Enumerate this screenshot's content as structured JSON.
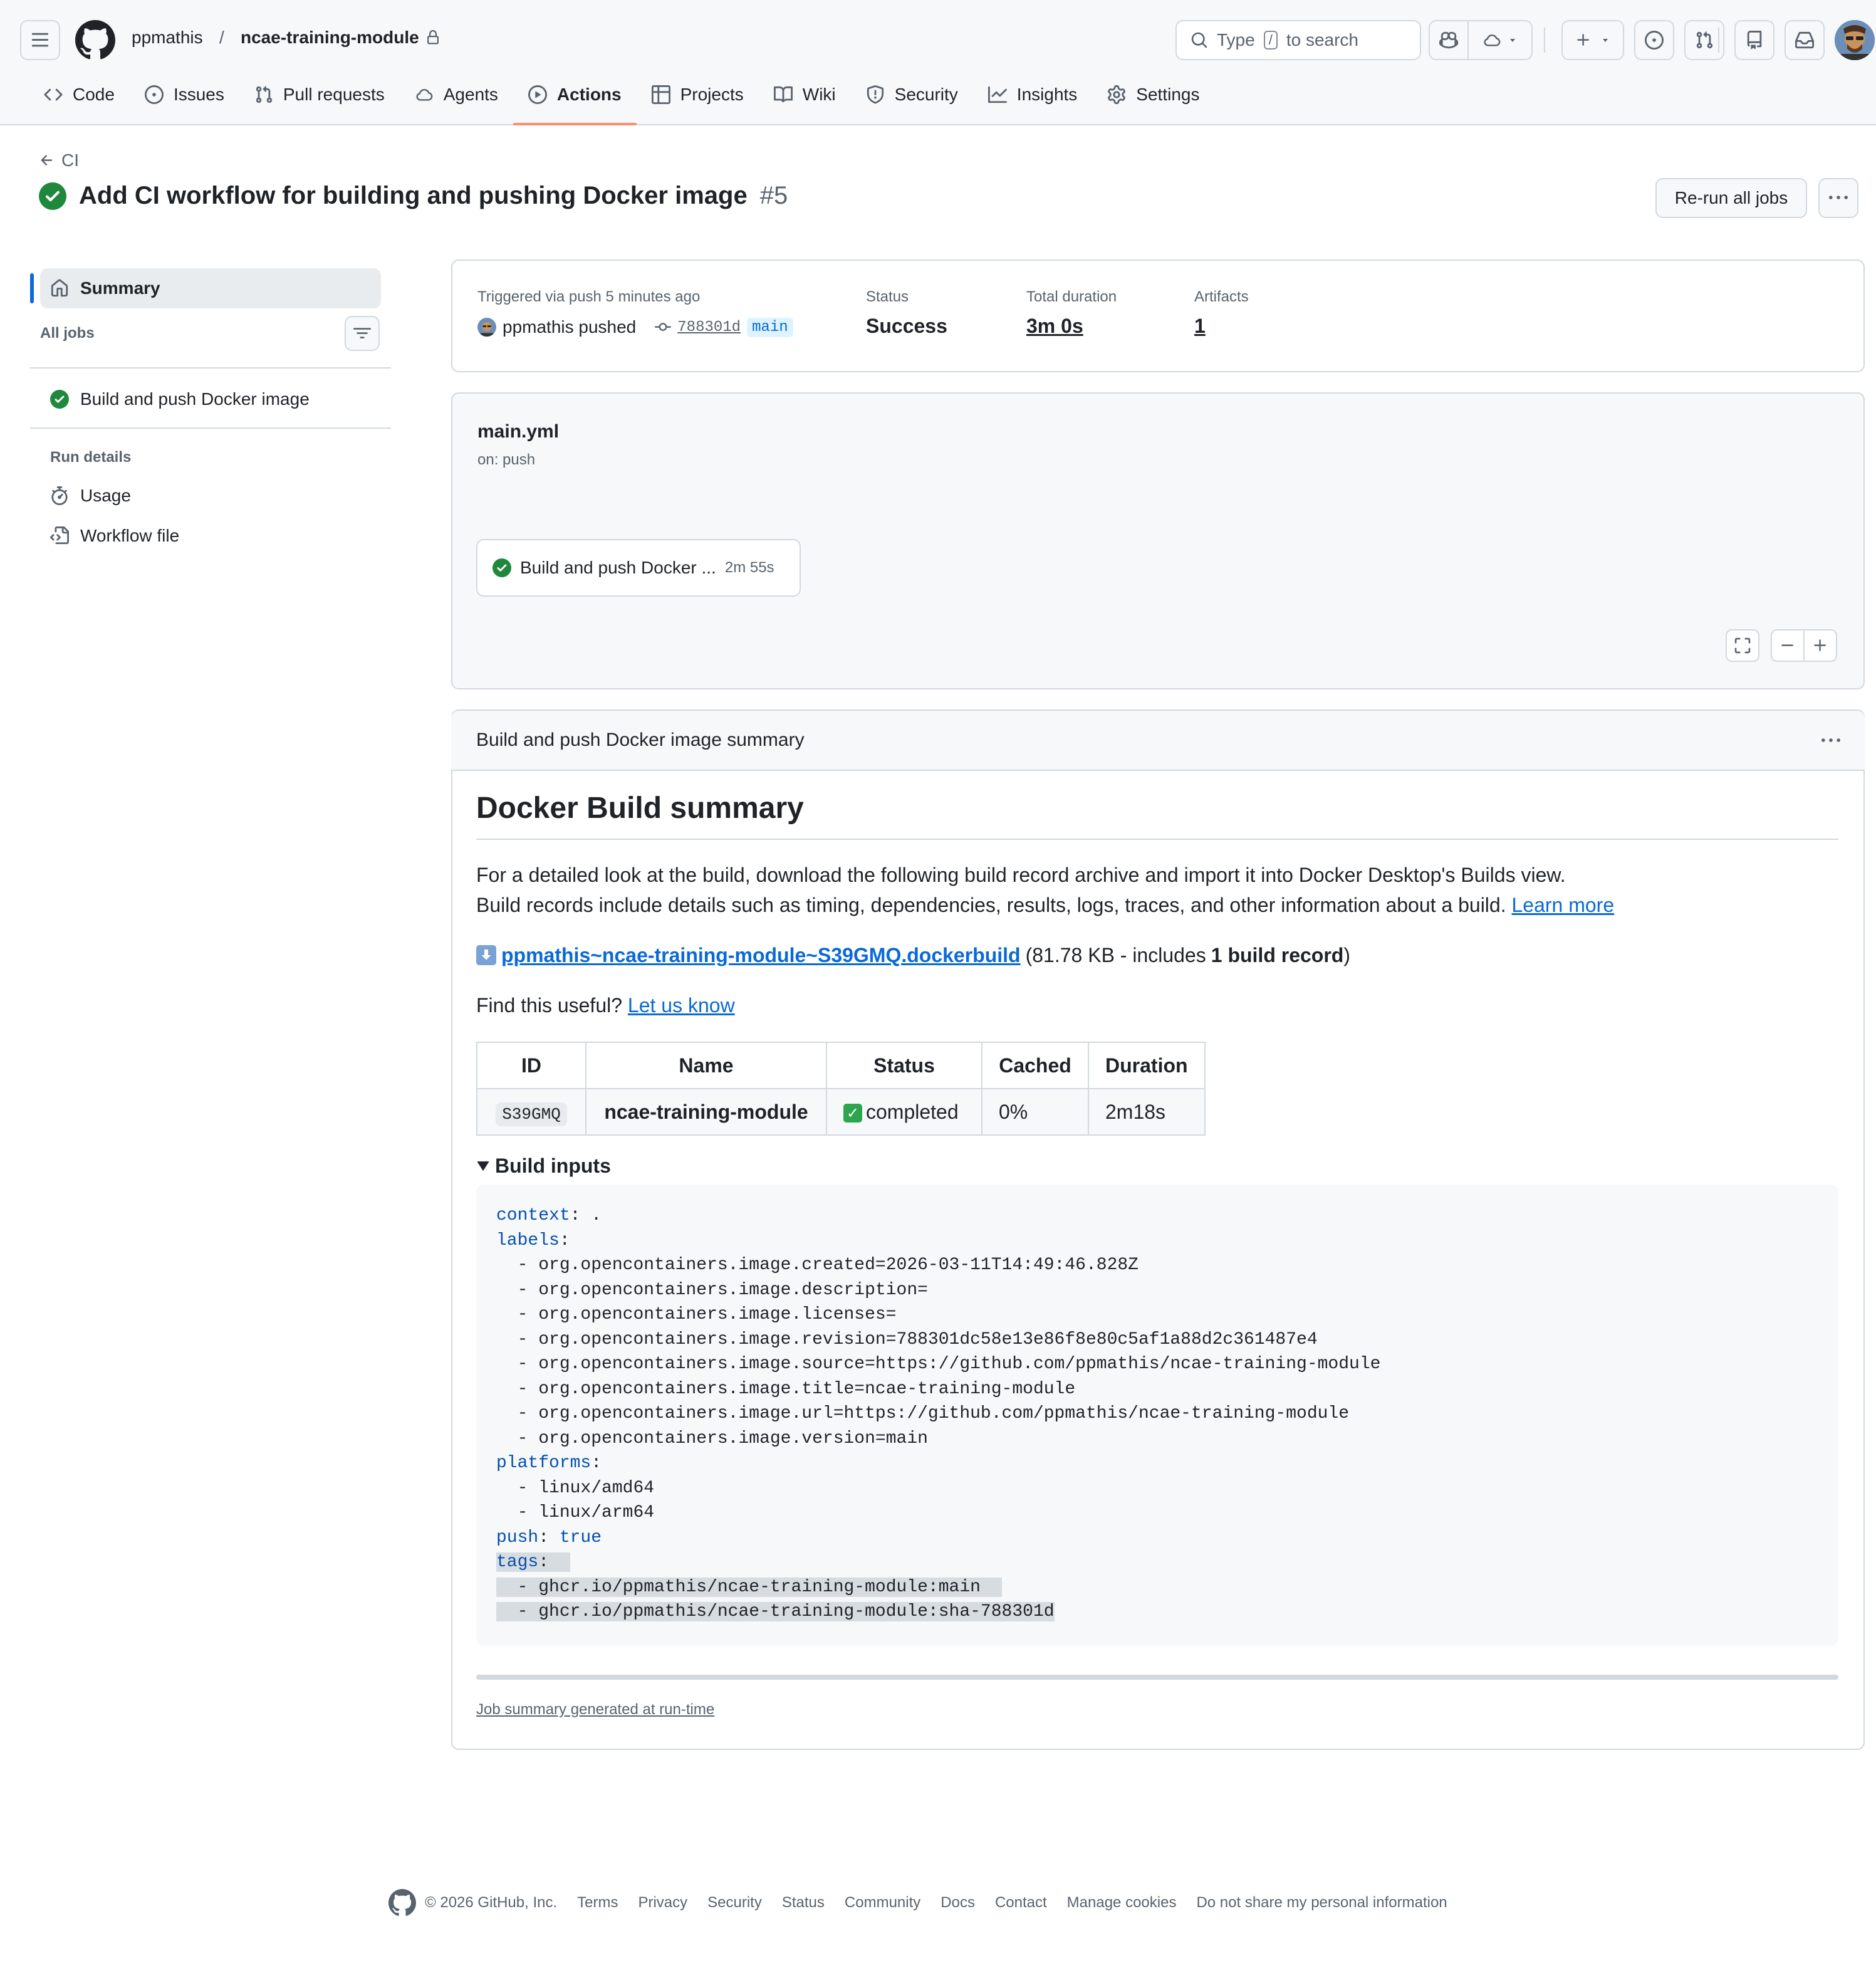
{
  "header": {
    "owner": "ppmathis",
    "separator": "/",
    "repo": "ncae-training-module",
    "search_prefix": "Type",
    "search_key": "/",
    "search_suffix": "to search"
  },
  "tabs": [
    {
      "label": "Code",
      "icon": "code-icon"
    },
    {
      "label": "Issues",
      "icon": "issue-icon"
    },
    {
      "label": "Pull requests",
      "icon": "pull-request-icon"
    },
    {
      "label": "Agents",
      "icon": "agent-icon"
    },
    {
      "label": "Actions",
      "icon": "play-icon",
      "active": true
    },
    {
      "label": "Projects",
      "icon": "table-icon"
    },
    {
      "label": "Wiki",
      "icon": "book-icon"
    },
    {
      "label": "Security",
      "icon": "shield-icon"
    },
    {
      "label": "Insights",
      "icon": "graph-icon"
    },
    {
      "label": "Settings",
      "icon": "gear-icon"
    }
  ],
  "run": {
    "back_label": "CI",
    "title": "Add CI workflow for building and pushing Docker image",
    "number": "#5",
    "rerun_label": "Re-run all jobs"
  },
  "sidebar": {
    "summary": "Summary",
    "all_jobs": "All jobs",
    "job": "Build and push Docker image",
    "run_details": "Run details",
    "usage": "Usage",
    "workflow_file": "Workflow file"
  },
  "overview": {
    "triggered": "Triggered via push 5 minutes ago",
    "actor": "ppmathis pushed",
    "commit": "788301d",
    "branch": "main",
    "status_label": "Status",
    "status_value": "Success",
    "duration_label": "Total duration",
    "duration_value": "3m 0s",
    "artifacts_label": "Artifacts",
    "artifacts_value": "1"
  },
  "workflow": {
    "file": "main.yml",
    "trigger": "on: push",
    "job_label": "Build and push Docker ...",
    "job_duration": "2m 55s"
  },
  "summary": {
    "header": "Build and push Docker image summary",
    "h2": "Docker Build summary",
    "p1": "For a detailed look at the build, download the following build record archive and import it into Docker Desktop's Builds view.",
    "p2": "Build records include details such as timing, dependencies, results, logs, traces, and other information about a build.",
    "learn_more": "Learn more",
    "archive_link": "ppmathis~ncae-training-module~S39GMQ.dockerbuild",
    "archive_meta_prefix": "(81.78 KB - includes",
    "archive_meta_bold": "1 build record",
    "archive_meta_suffix": ")",
    "useful_prefix": "Find this useful?",
    "useful_link": "Let us know",
    "table": {
      "headers": [
        "ID",
        "Name",
        "Status",
        "Cached",
        "Duration"
      ],
      "row": {
        "id": "S39GMQ",
        "name": "ncae-training-module",
        "status": "completed",
        "cached": "0%",
        "duration": "2m18s"
      }
    },
    "build_inputs_label": "Build inputs",
    "code": {
      "context_key": "context",
      "context_val": ".",
      "labels_key": "labels",
      "labels": [
        "org.opencontainers.image.created=2026-03-11T14:49:46.828Z",
        "org.opencontainers.image.description=",
        "org.opencontainers.image.licenses=",
        "org.opencontainers.image.revision=788301dc58e13e86f8e80c5af1a88d2c361487e4",
        "org.opencontainers.image.source=https://github.com/ppmathis/ncae-training-module",
        "org.opencontainers.image.title=ncae-training-module",
        "org.opencontainers.image.url=https://github.com/ppmathis/ncae-training-module",
        "org.opencontainers.image.version=main"
      ],
      "platforms_key": "platforms",
      "platforms": [
        "linux/amd64",
        "linux/arm64"
      ],
      "push_key": "push",
      "push_val": "true",
      "tags_key": "tags",
      "tags": [
        "ghcr.io/ppmathis/ncae-training-module:main",
        "ghcr.io/ppmathis/ncae-training-module:sha-788301d"
      ]
    },
    "footer_note": "Job summary generated at run-time"
  },
  "footer": {
    "copyright": "© 2026 GitHub, Inc.",
    "links": [
      "Terms",
      "Privacy",
      "Security",
      "Status",
      "Community",
      "Docs",
      "Contact",
      "Manage cookies",
      "Do not share my personal information"
    ]
  },
  "colors": {
    "success": "#1f883d",
    "link": "#0969da",
    "accent_tab": "#fd8c73"
  }
}
